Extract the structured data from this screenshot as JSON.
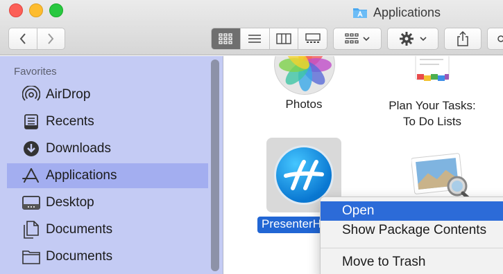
{
  "window": {
    "title": "Applications"
  },
  "toolbar": {
    "back_icon": "chevron-left-icon",
    "forward_icon": "chevron-right-icon",
    "view_modes": [
      "icon-view",
      "list-view",
      "column-view",
      "gallery-view"
    ],
    "active_view": "icon-view"
  },
  "sidebar": {
    "heading": "Favorites",
    "items": [
      {
        "label": "AirDrop",
        "icon": "airdrop-icon"
      },
      {
        "label": "Recents",
        "icon": "recents-icon"
      },
      {
        "label": "Downloads",
        "icon": "downloads-icon"
      },
      {
        "label": "Applications",
        "icon": "applications-icon",
        "selected": true
      },
      {
        "label": "Desktop",
        "icon": "desktop-icon"
      },
      {
        "label": "Documents",
        "icon": "documents-icon"
      },
      {
        "label": "Documents",
        "icon": "folder-icon"
      }
    ]
  },
  "files": {
    "photos": {
      "label": "Photos"
    },
    "plan": {
      "label_line1": "Plan Your Tasks:",
      "label_line2": "To Do Lists"
    },
    "presenter": {
      "label": "PresenterH"
    }
  },
  "context_menu": {
    "items": [
      "Open",
      "Show Package Contents",
      "Move to Trash"
    ],
    "highlighted": "Open"
  },
  "colors": {
    "sidebar_bg": "#c4cbf4",
    "sidebar_selected": "#a3aef0",
    "selection_blue": "#2166d4",
    "menu_highlight": "#2c6bd8"
  }
}
